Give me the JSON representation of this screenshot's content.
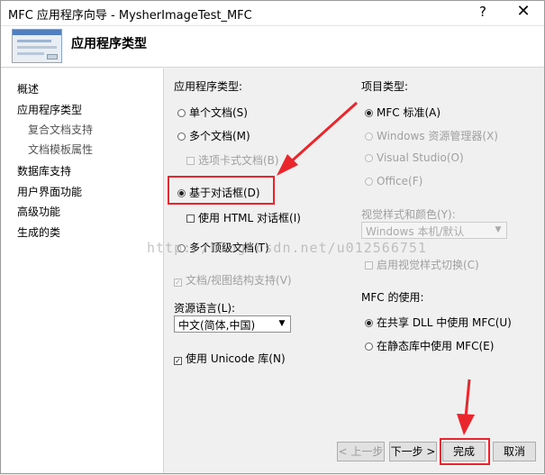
{
  "window": {
    "title": "MFC 应用程序向导 - MysherImageTest_MFC",
    "help_glyph": "?",
    "close_glyph": "✕"
  },
  "banner": {
    "title": "应用程序类型"
  },
  "nav": {
    "items": [
      {
        "label": "概述"
      },
      {
        "label": "应用程序类型"
      },
      {
        "label": "复合文档支持"
      },
      {
        "label": "文档模板属性"
      },
      {
        "label": "数据库支持"
      },
      {
        "label": "用户界面功能"
      },
      {
        "label": "高级功能"
      },
      {
        "label": "生成的类"
      }
    ]
  },
  "app_type": {
    "label": "应用程序类型:",
    "single_doc": "单个文档(S)",
    "multi_doc": "多个文档(M)",
    "tabbed_docs": "选项卡式文档(B)",
    "dialog_based": "基于对话框(D)",
    "html_dialog": "使用 HTML 对话框(I)",
    "multi_top_level": "多个顶级文档(T)",
    "doc_view_support": "文档/视图结构支持(V)",
    "selected": "基于对话框(D)"
  },
  "resource_lang": {
    "label": "资源语言(L):",
    "value": "中文(简体,中国)"
  },
  "unicode": {
    "label": "使用 Unicode 库(N)",
    "checked": true
  },
  "project_type": {
    "label": "项目类型:",
    "mfc_standard": "MFC 标准(A)",
    "windows_explorer": "Windows 资源管理器(X)",
    "visual_studio": "Visual Studio(O)",
    "office": "Office(F)"
  },
  "visual_style": {
    "label": "视觉样式和颜色(Y):",
    "value": "Windows 本机/默认",
    "enable_switch": "启用视觉样式切换(C)"
  },
  "mfc_use": {
    "label": "MFC 的使用:",
    "shared_dll": "在共享 DLL 中使用 MFC(U)",
    "static_lib": "在静态库中使用 MFC(E)"
  },
  "buttons": {
    "prev": "< 上一步",
    "next": "下一步 >",
    "finish": "完成",
    "cancel": "取消"
  },
  "watermark": "http://blog.csdn.net/u012566751",
  "annotation_color": "#e8262b"
}
